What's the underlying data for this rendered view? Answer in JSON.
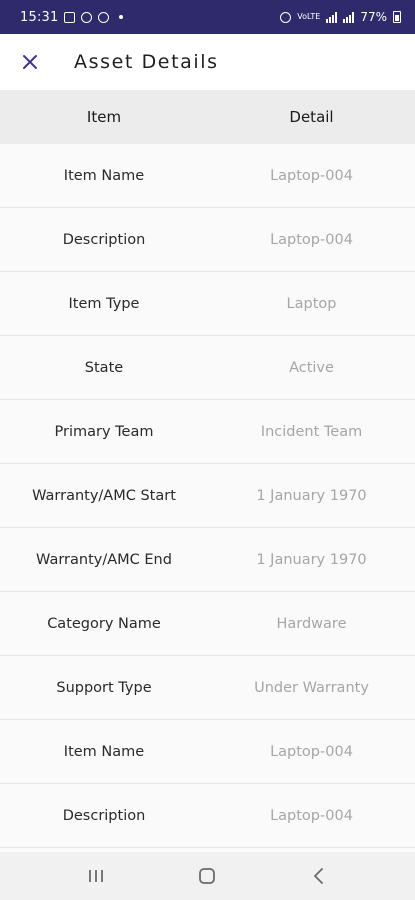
{
  "status_bar": {
    "time": "15:31",
    "network": "VoLTE",
    "battery": "77%"
  },
  "app_bar": {
    "close_icon": "close-icon",
    "title": "Asset Details"
  },
  "table": {
    "headers": {
      "item": "Item",
      "detail": "Detail"
    },
    "rows": [
      {
        "item": "Item Name",
        "detail": "Laptop-004"
      },
      {
        "item": "Description",
        "detail": "Laptop-004"
      },
      {
        "item": "Item Type",
        "detail": "Laptop"
      },
      {
        "item": "State",
        "detail": "Active"
      },
      {
        "item": "Primary Team",
        "detail": "Incident Team"
      },
      {
        "item": "Warranty/AMC Start",
        "detail": "1 January 1970"
      },
      {
        "item": "Warranty/AMC End",
        "detail": "1 January 1970"
      },
      {
        "item": "Category Name",
        "detail": "Hardware"
      },
      {
        "item": "Support Type",
        "detail": "Under Warranty"
      },
      {
        "item": "Item Name",
        "detail": "Laptop-004"
      },
      {
        "item": "Description",
        "detail": "Laptop-004"
      }
    ]
  },
  "nav_bar": {
    "recent_icon": "recent-apps-icon",
    "home_icon": "home-icon",
    "back_icon": "back-icon"
  },
  "colors": {
    "status_bar_bg": "#2f2a6b",
    "accent": "#3d3a8c",
    "header_bg": "#ececec",
    "detail_text": "#a6a6a6"
  }
}
